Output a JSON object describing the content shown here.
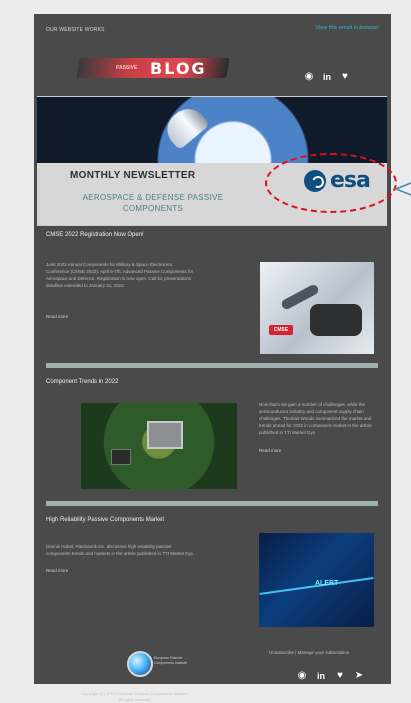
{
  "top": {
    "left_text": "OUR WEBSITE WORKS",
    "right_text": "View this email in browser",
    "social_icons": [
      "globe-icon",
      "linkedin-icon",
      "twitter-icon"
    ]
  },
  "logo": {
    "small": "PASSIVE",
    "big": "BLOG"
  },
  "hero": {
    "title": "MONTHLY NEWSLETTER",
    "subtitle": "AEROSPACE & DEFENSE PASSIVE COMPONENTS",
    "esa_text": "esa"
  },
  "sections": [
    {
      "title": "CMSE 2022 Registration Now Open!",
      "body": "Joint 2022 Annual Components for Military & Space Electronics Conference (CMSE 2022), April 5-7th. Advanced Passive Components for Aerospace and Defence. Registration is now open. Call for presentations deadline extended to January 31, 2022.",
      "read_more": "Read more"
    },
    {
      "title": "Component Trends in 2022",
      "body": "Now that’s we gain a number of challenges, while the semiconductor industry and component supply chain challenges. Thomas Woods summarized the market and trends ahead for 2022 in component market in the article published in TTI Market Eye.",
      "read_more": "Read more"
    },
    {
      "title": "High Reliability Passive Components Market",
      "body": "Dennis Hubel, Paumanok Inc. discusses high reliability passive components trends and markets in the article published in TTI Market Eye.",
      "read_more": "Read more"
    }
  ],
  "footer": {
    "logo_text": "European Passive Components Institute",
    "links": "Unsubscribe | Manage your subscription",
    "social_icons": [
      "globe-icon",
      "linkedin-icon",
      "twitter-icon",
      "telegram-icon"
    ],
    "copyright": "Copyright (C) 2022 European Passive Components Institute. All rights reserved."
  }
}
